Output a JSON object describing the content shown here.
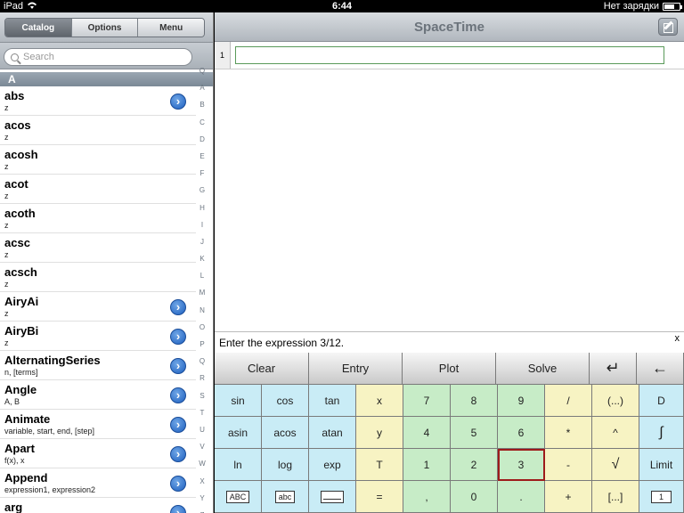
{
  "status": {
    "device": "iPad",
    "time": "6:44",
    "battery_text": "Нет зарядки"
  },
  "catalog": {
    "tabs": [
      "Catalog",
      "Options",
      "Menu"
    ],
    "search_placeholder": "Search",
    "section": "A",
    "items": [
      {
        "name": "abs",
        "args": "z",
        "disclosure": true
      },
      {
        "name": "acos",
        "args": "z",
        "disclosure": false
      },
      {
        "name": "acosh",
        "args": "z",
        "disclosure": false
      },
      {
        "name": "acot",
        "args": "z",
        "disclosure": false
      },
      {
        "name": "acoth",
        "args": "z",
        "disclosure": false
      },
      {
        "name": "acsc",
        "args": "z",
        "disclosure": false
      },
      {
        "name": "acsch",
        "args": "z",
        "disclosure": false
      },
      {
        "name": "AiryAi",
        "args": "z",
        "disclosure": true
      },
      {
        "name": "AiryBi",
        "args": "z",
        "disclosure": true
      },
      {
        "name": "AlternatingSeries",
        "args": "n, [terms]",
        "disclosure": true
      },
      {
        "name": "Angle",
        "args": "A, B",
        "disclosure": true
      },
      {
        "name": "Animate",
        "args": "variable, start, end, [step]",
        "disclosure": true
      },
      {
        "name": "Apart",
        "args": "f(x), x",
        "disclosure": true
      },
      {
        "name": "Append",
        "args": "expression1, expression2",
        "disclosure": true
      },
      {
        "name": "arg",
        "args": "",
        "disclosure": true
      }
    ],
    "index_letters": [
      "Q",
      "A",
      "B",
      "C",
      "D",
      "E",
      "F",
      "G",
      "H",
      "I",
      "J",
      "K",
      "L",
      "M",
      "N",
      "O",
      "P",
      "Q",
      "R",
      "S",
      "T",
      "U",
      "V",
      "W",
      "X",
      "Y",
      "Z"
    ]
  },
  "app": {
    "title": "SpaceTime",
    "line_number": "1"
  },
  "hint": {
    "text": "Enter the expression 3/12.",
    "close": "x"
  },
  "keyboard": {
    "top": [
      "Clear",
      "Entry",
      "Plot",
      "Solve",
      "↵",
      "←"
    ],
    "rows": [
      [
        "sin",
        "cos",
        "tan",
        "x",
        "7",
        "8",
        "9",
        "/",
        "(...)",
        "D"
      ],
      [
        "asin",
        "acos",
        "atan",
        "y",
        "4",
        "5",
        "6",
        "*",
        "^",
        "∫"
      ],
      [
        "ln",
        "log",
        "exp",
        "T",
        "1",
        "2",
        "3",
        "-",
        "√",
        "Limit"
      ],
      [
        "ABC",
        "abc",
        "",
        "=",
        ",",
        "0",
        ".",
        "+",
        "[...]",
        "1"
      ]
    ]
  }
}
